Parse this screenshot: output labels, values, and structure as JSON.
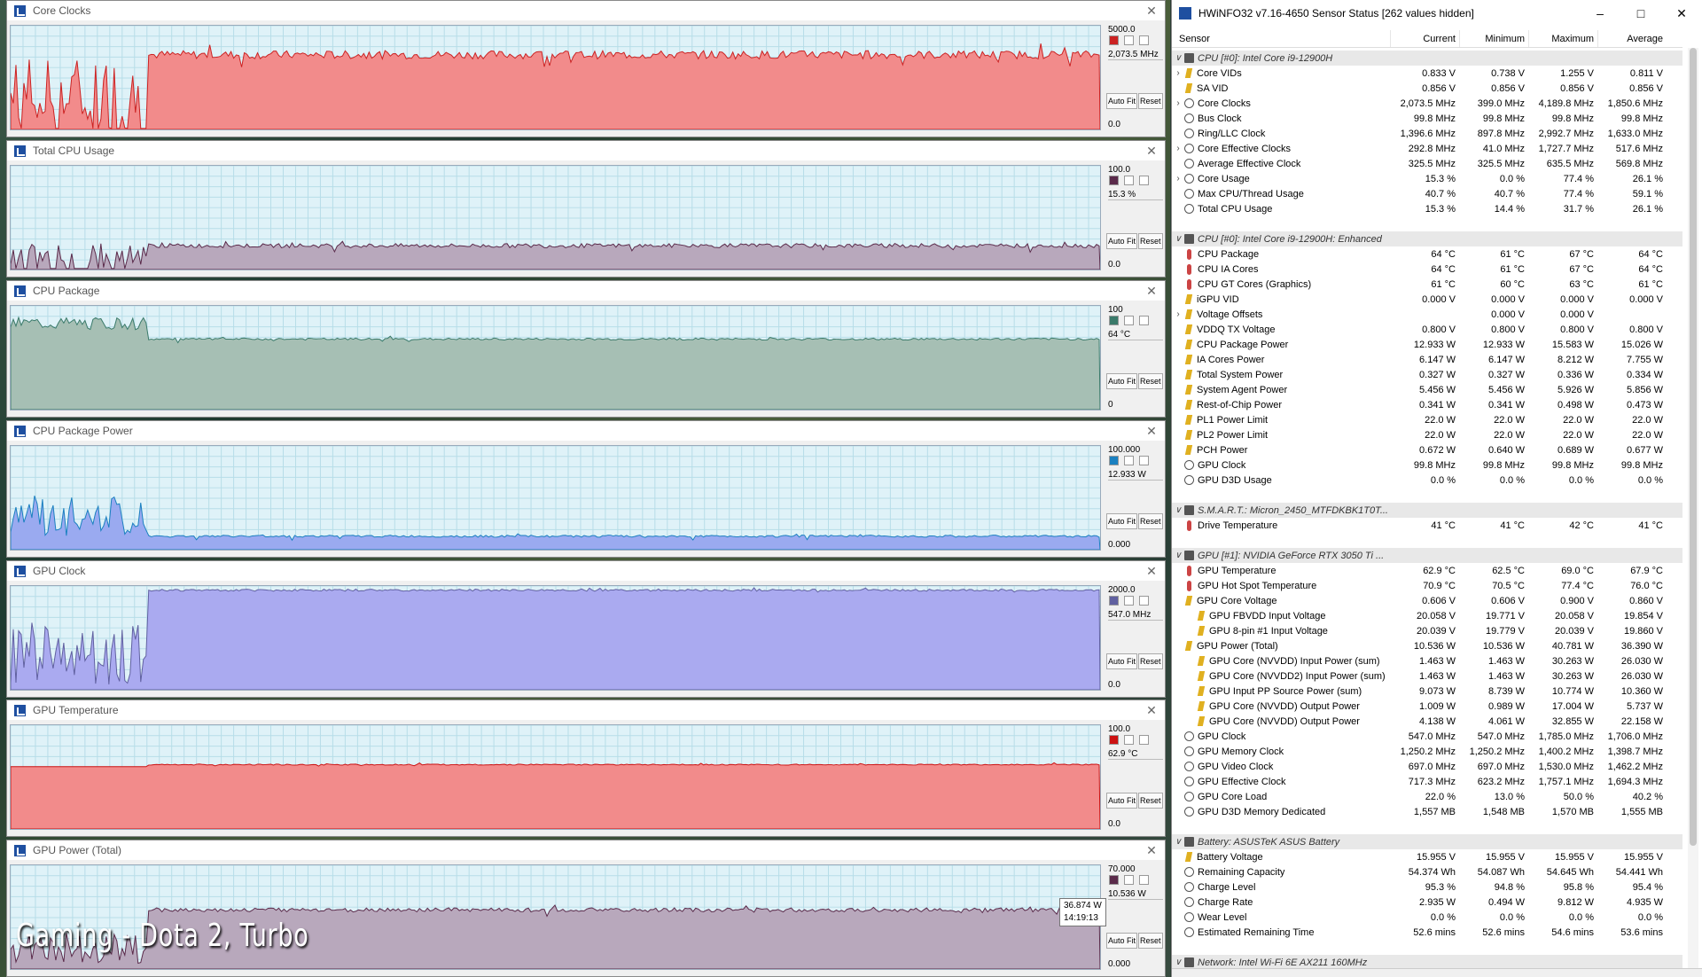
{
  "caption": "Gaming - Dota 2, Turbo",
  "tooltip": {
    "value": "36.874 W",
    "time": "14:19:13"
  },
  "graphs": [
    {
      "title": "Core Clocks",
      "max": "5000.0",
      "current": "2,073.5 MHz",
      "min": "0.0",
      "color": "#f28b8b",
      "stroke": "#cc2222",
      "buttons": [
        "Auto Fit",
        "Reset"
      ]
    },
    {
      "title": "Total CPU Usage",
      "max": "100.0",
      "current": "15.3 %",
      "min": "0.0",
      "color": "#b8a8bc",
      "stroke": "#5a2a4a",
      "buttons": [
        "Auto Fit",
        "Reset"
      ]
    },
    {
      "title": "CPU Package",
      "max": "100",
      "current": "64 °C",
      "min": "0",
      "color": "#a6bfb4",
      "stroke": "#3a7a6a",
      "buttons": [
        "Auto Fit",
        "Reset"
      ]
    },
    {
      "title": "CPU Package Power",
      "max": "100.000",
      "current": "12.933 W",
      "min": "0.000",
      "color": "#9aaaf0",
      "stroke": "#1a80c0",
      "buttons": [
        "Auto Fit",
        "Reset"
      ]
    },
    {
      "title": "GPU Clock",
      "max": "2000.0",
      "current": "547.0 MHz",
      "min": "0.0",
      "color": "#aaaaf0",
      "stroke": "#6060a0",
      "buttons": [
        "Auto Fit",
        "Reset"
      ]
    },
    {
      "title": "GPU Temperature",
      "max": "100.0",
      "current": "62.9 °C",
      "min": "0.0",
      "color": "#f28b8b",
      "stroke": "#cc1111",
      "buttons": [
        "Auto Fit",
        "Reset"
      ]
    },
    {
      "title": "GPU Power (Total)",
      "max": "70.000",
      "current": "10.536 W",
      "min": "0.000",
      "color": "#b8a8bc",
      "stroke": "#5a2a4a",
      "buttons": [
        "Auto Fit",
        "Reset"
      ]
    }
  ],
  "hwinfo": {
    "title": "HWiNFO32 v7.16-4650 Sensor Status [262 values hidden]",
    "columns": [
      "Sensor",
      "Current",
      "Minimum",
      "Maximum",
      "Average"
    ],
    "rows": [
      {
        "t": "g",
        "n": "CPU [#0]: Intel Core i9-12900H"
      },
      {
        "i": "bolt",
        "e": true,
        "n": "Core VIDs",
        "v": [
          "0.833 V",
          "0.738 V",
          "1.255 V",
          "0.811 V"
        ]
      },
      {
        "i": "bolt",
        "n": "SA VID",
        "v": [
          "0.856 V",
          "0.856 V",
          "0.856 V",
          "0.856 V"
        ]
      },
      {
        "i": "clock",
        "e": true,
        "n": "Core Clocks",
        "v": [
          "2,073.5 MHz",
          "399.0 MHz",
          "4,189.8 MHz",
          "1,850.6 MHz"
        ]
      },
      {
        "i": "clock",
        "n": "Bus Clock",
        "v": [
          "99.8 MHz",
          "99.8 MHz",
          "99.8 MHz",
          "99.8 MHz"
        ]
      },
      {
        "i": "clock",
        "n": "Ring/LLC Clock",
        "v": [
          "1,396.6 MHz",
          "897.8 MHz",
          "2,992.7 MHz",
          "1,633.0 MHz"
        ]
      },
      {
        "i": "clock",
        "e": true,
        "n": "Core Effective Clocks",
        "v": [
          "292.8 MHz",
          "41.0 MHz",
          "1,727.7 MHz",
          "517.6 MHz"
        ]
      },
      {
        "i": "clock",
        "n": "Average Effective Clock",
        "v": [
          "325.5 MHz",
          "325.5 MHz",
          "635.5 MHz",
          "569.8 MHz"
        ]
      },
      {
        "i": "clock",
        "e": true,
        "n": "Core Usage",
        "v": [
          "15.3 %",
          "0.0 %",
          "77.4 %",
          "26.1 %"
        ]
      },
      {
        "i": "clock",
        "n": "Max CPU/Thread Usage",
        "v": [
          "40.7 %",
          "40.7 %",
          "77.4 %",
          "59.1 %"
        ]
      },
      {
        "i": "clock",
        "n": "Total CPU Usage",
        "v": [
          "15.3 %",
          "14.4 %",
          "31.7 %",
          "26.1 %"
        ]
      },
      {
        "t": "b"
      },
      {
        "t": "g",
        "n": "CPU [#0]: Intel Core i9-12900H: Enhanced"
      },
      {
        "i": "therm",
        "n": "CPU Package",
        "v": [
          "64 °C",
          "61 °C",
          "67 °C",
          "64 °C"
        ]
      },
      {
        "i": "therm",
        "n": "CPU IA Cores",
        "v": [
          "64 °C",
          "61 °C",
          "67 °C",
          "64 °C"
        ]
      },
      {
        "i": "therm",
        "n": "CPU GT Cores (Graphics)",
        "v": [
          "61 °C",
          "60 °C",
          "63 °C",
          "61 °C"
        ]
      },
      {
        "i": "bolt",
        "n": "iGPU VID",
        "v": [
          "0.000 V",
          "0.000 V",
          "0.000 V",
          "0.000 V"
        ]
      },
      {
        "i": "bolt",
        "e": true,
        "n": "Voltage Offsets",
        "v": [
          "",
          "0.000 V",
          "0.000 V",
          ""
        ]
      },
      {
        "i": "bolt",
        "n": "VDDQ TX Voltage",
        "v": [
          "0.800 V",
          "0.800 V",
          "0.800 V",
          "0.800 V"
        ]
      },
      {
        "i": "bolt",
        "n": "CPU Package Power",
        "v": [
          "12.933 W",
          "12.933 W",
          "15.583 W",
          "15.026 W"
        ]
      },
      {
        "i": "bolt",
        "n": "IA Cores Power",
        "v": [
          "6.147 W",
          "6.147 W",
          "8.212 W",
          "7.755 W"
        ]
      },
      {
        "i": "bolt",
        "n": "Total System Power",
        "v": [
          "0.327 W",
          "0.327 W",
          "0.336 W",
          "0.334 W"
        ]
      },
      {
        "i": "bolt",
        "n": "System Agent Power",
        "v": [
          "5.456 W",
          "5.456 W",
          "5.926 W",
          "5.856 W"
        ]
      },
      {
        "i": "bolt",
        "n": "Rest-of-Chip Power",
        "v": [
          "0.341 W",
          "0.341 W",
          "0.498 W",
          "0.473 W"
        ]
      },
      {
        "i": "bolt",
        "n": "PL1 Power Limit",
        "v": [
          "22.0 W",
          "22.0 W",
          "22.0 W",
          "22.0 W"
        ]
      },
      {
        "i": "bolt",
        "n": "PL2 Power Limit",
        "v": [
          "22.0 W",
          "22.0 W",
          "22.0 W",
          "22.0 W"
        ]
      },
      {
        "i": "bolt",
        "n": "PCH Power",
        "v": [
          "0.672 W",
          "0.640 W",
          "0.689 W",
          "0.677 W"
        ]
      },
      {
        "i": "clock",
        "n": "GPU Clock",
        "v": [
          "99.8 MHz",
          "99.8 MHz",
          "99.8 MHz",
          "99.8 MHz"
        ]
      },
      {
        "i": "clock",
        "n": "GPU D3D Usage",
        "v": [
          "0.0 %",
          "0.0 %",
          "0.0 %",
          "0.0 %"
        ]
      },
      {
        "t": "b"
      },
      {
        "t": "g",
        "n": "S.M.A.R.T.: Micron_2450_MTFDKBK1T0T..."
      },
      {
        "i": "therm",
        "n": "Drive Temperature",
        "v": [
          "41 °C",
          "41 °C",
          "42 °C",
          "41 °C"
        ]
      },
      {
        "t": "b"
      },
      {
        "t": "g",
        "n": "GPU [#1]: NVIDIA GeForce RTX 3050 Ti ..."
      },
      {
        "i": "therm",
        "n": "GPU Temperature",
        "v": [
          "62.9 °C",
          "62.5 °C",
          "69.0 °C",
          "67.9 °C"
        ]
      },
      {
        "i": "therm",
        "n": "GPU Hot Spot Temperature",
        "v": [
          "70.9 °C",
          "70.5 °C",
          "77.4 °C",
          "76.0 °C"
        ]
      },
      {
        "i": "bolt",
        "n": "GPU Core Voltage",
        "v": [
          "0.606 V",
          "0.606 V",
          "0.900 V",
          "0.860 V"
        ]
      },
      {
        "i": "bolt",
        "s": true,
        "n": "GPU FBVDD Input Voltage",
        "v": [
          "20.058 V",
          "19.771 V",
          "20.058 V",
          "19.854 V"
        ]
      },
      {
        "i": "bolt",
        "s": true,
        "n": "GPU 8-pin #1 Input Voltage",
        "v": [
          "20.039 V",
          "19.779 V",
          "20.039 V",
          "19.860 V"
        ]
      },
      {
        "i": "bolt",
        "n": "GPU Power (Total)",
        "v": [
          "10.536 W",
          "10.536 W",
          "40.781 W",
          "36.390 W"
        ]
      },
      {
        "i": "bolt",
        "s": true,
        "n": "GPU Core (NVVDD) Input Power (sum)",
        "v": [
          "1.463 W",
          "1.463 W",
          "30.263 W",
          "26.030 W"
        ]
      },
      {
        "i": "bolt",
        "s": true,
        "n": "GPU Core (NVVDD2) Input Power (sum)",
        "v": [
          "1.463 W",
          "1.463 W",
          "30.263 W",
          "26.030 W"
        ]
      },
      {
        "i": "bolt",
        "s": true,
        "n": "GPU Input PP Source Power (sum)",
        "v": [
          "9.073 W",
          "8.739 W",
          "10.774 W",
          "10.360 W"
        ]
      },
      {
        "i": "bolt",
        "s": true,
        "n": "GPU Core (NVVDD) Output Power",
        "v": [
          "1.009 W",
          "0.989 W",
          "17.004 W",
          "5.737 W"
        ]
      },
      {
        "i": "bolt",
        "s": true,
        "n": "GPU Core (NVVDD) Output Power",
        "v": [
          "4.138 W",
          "4.061 W",
          "32.855 W",
          "22.158 W"
        ]
      },
      {
        "i": "clock",
        "n": "GPU Clock",
        "v": [
          "547.0 MHz",
          "547.0 MHz",
          "1,785.0 MHz",
          "1,706.0 MHz"
        ]
      },
      {
        "i": "clock",
        "n": "GPU Memory Clock",
        "v": [
          "1,250.2 MHz",
          "1,250.2 MHz",
          "1,400.2 MHz",
          "1,398.7 MHz"
        ]
      },
      {
        "i": "clock",
        "n": "GPU Video Clock",
        "v": [
          "697.0 MHz",
          "697.0 MHz",
          "1,530.0 MHz",
          "1,462.2 MHz"
        ]
      },
      {
        "i": "clock",
        "n": "GPU Effective Clock",
        "v": [
          "717.3 MHz",
          "623.2 MHz",
          "1,757.1 MHz",
          "1,694.3 MHz"
        ]
      },
      {
        "i": "clock",
        "n": "GPU Core Load",
        "v": [
          "22.0 %",
          "13.0 %",
          "50.0 %",
          "40.2 %"
        ]
      },
      {
        "i": "clock",
        "n": "GPU D3D Memory Dedicated",
        "v": [
          "1,557 MB",
          "1,548 MB",
          "1,570 MB",
          "1,555 MB"
        ]
      },
      {
        "t": "b"
      },
      {
        "t": "g",
        "n": "Battery: ASUSTeK ASUS Battery"
      },
      {
        "i": "bolt",
        "n": "Battery Voltage",
        "v": [
          "15.955 V",
          "15.955 V",
          "15.955 V",
          "15.955 V"
        ]
      },
      {
        "i": "clock",
        "n": "Remaining Capacity",
        "v": [
          "54.374 Wh",
          "54.087 Wh",
          "54.645 Wh",
          "54.441 Wh"
        ]
      },
      {
        "i": "clock",
        "n": "Charge Level",
        "v": [
          "95.3 %",
          "94.8 %",
          "95.8 %",
          "95.4 %"
        ]
      },
      {
        "i": "clock",
        "n": "Charge Rate",
        "v": [
          "2.935 W",
          "0.494 W",
          "9.812 W",
          "4.935 W"
        ]
      },
      {
        "i": "clock",
        "n": "Wear Level",
        "v": [
          "0.0 %",
          "0.0 %",
          "0.0 %",
          "0.0 %"
        ]
      },
      {
        "i": "clock",
        "n": "Estimated Remaining Time",
        "v": [
          "52.6 mins",
          "52.6 mins",
          "54.6 mins",
          "53.6 mins"
        ]
      },
      {
        "t": "b"
      },
      {
        "t": "g",
        "n": "Network: Intel Wi-Fi 6E AX211 160MHz"
      }
    ]
  }
}
